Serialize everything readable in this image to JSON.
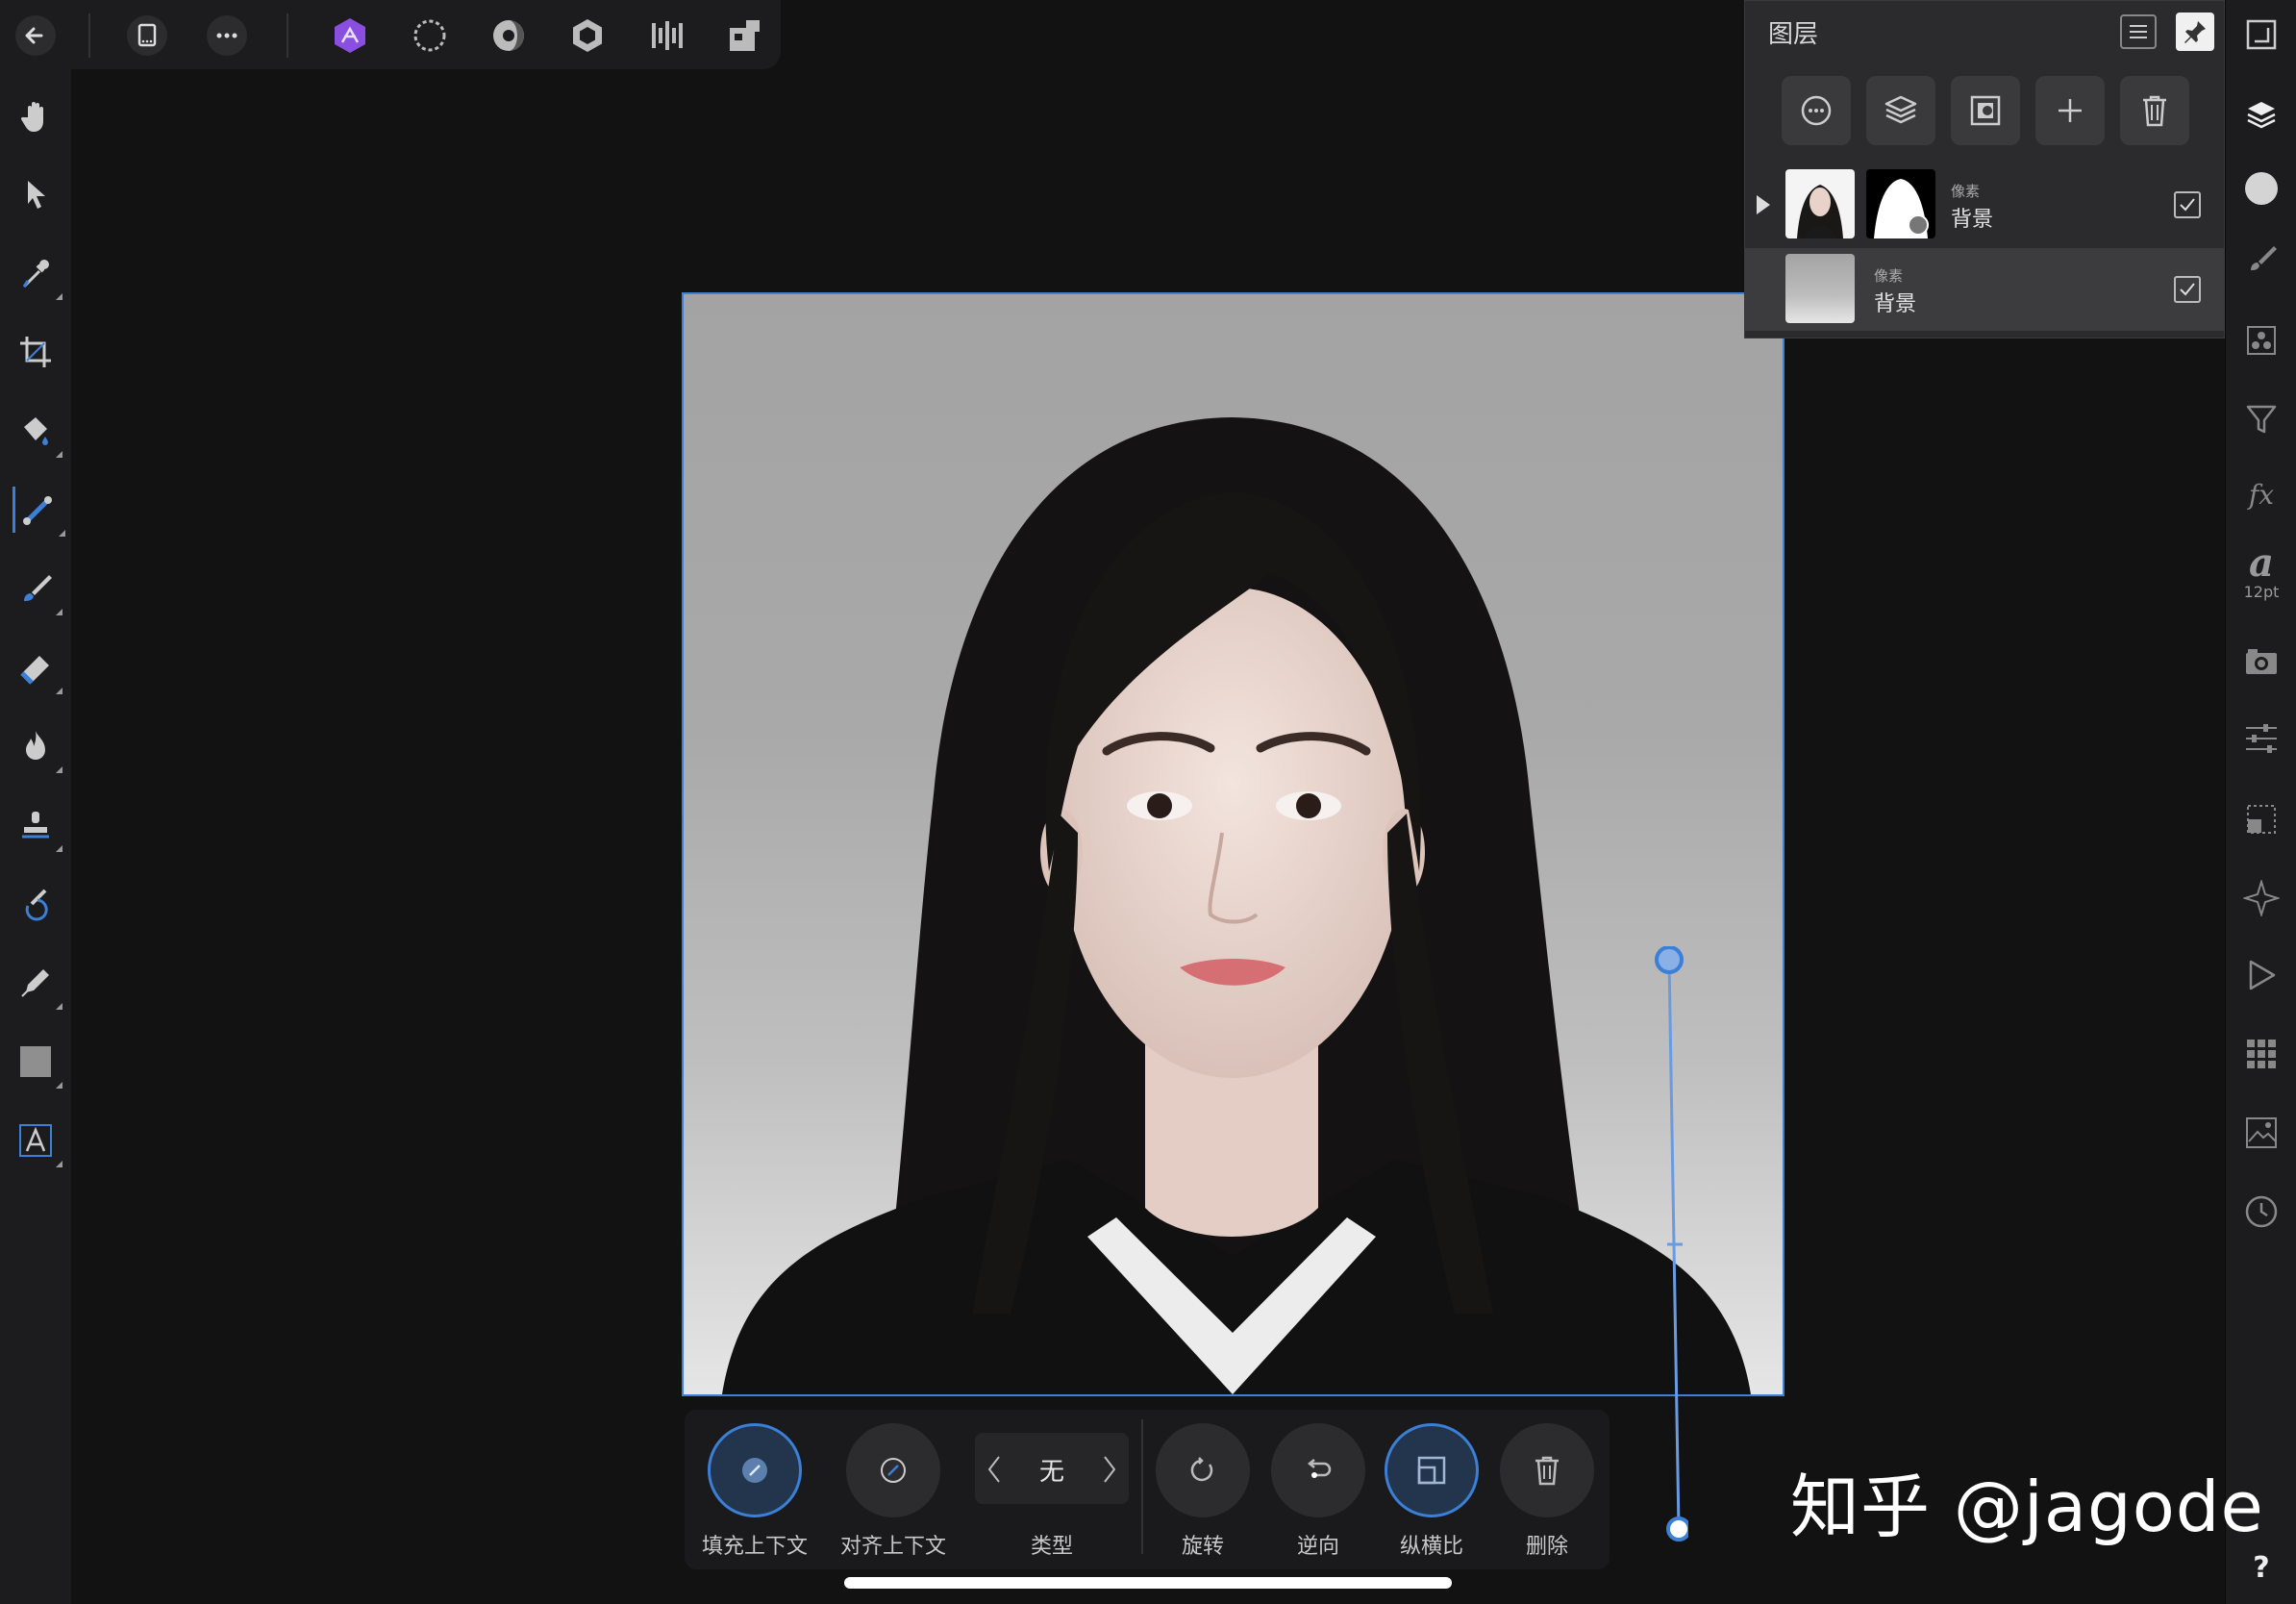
{
  "top_toolbar": {
    "items": [
      "back-icon",
      "document-icon",
      "more-icon",
      "photo-persona-icon",
      "liquify-persona-icon",
      "develop-persona-icon",
      "tone-mapping-persona-icon",
      "export-persona-icon",
      "pixel-persona-icon"
    ]
  },
  "left_tools": [
    "view-tool",
    "move-tool",
    "color-picker-tool",
    "crop-tool",
    "flood-fill-tool",
    "gradient-tool",
    "paint-brush-tool",
    "erase-brush-tool",
    "burn-brush-tool",
    "clone-tool",
    "undo-brush-tool",
    "pen-tool",
    "rectangle-tool",
    "artistic-text-tool"
  ],
  "right_strip": {
    "items": [
      "canvas-icon",
      "layers-icon",
      "color-icon",
      "brushes-icon",
      "channels-icon",
      "filter-icon",
      "fx-icon",
      "text-icon",
      "camera-icon",
      "adjustments-icon",
      "transform-icon",
      "navigator-icon",
      "macro-icon",
      "stock-icon",
      "image-icon",
      "history-icon",
      "help-icon"
    ],
    "text_size": "12pt",
    "fx_label": "fx",
    "text_glyph": "a",
    "help": "?"
  },
  "layers_panel": {
    "title": "图层",
    "layers": [
      {
        "type": "像素",
        "name": "背景",
        "checked": true,
        "expandable": true
      },
      {
        "type": "像素",
        "name": "背景",
        "checked": true,
        "expandable": false
      }
    ]
  },
  "context_toolbar": {
    "fill_context": "填充上下文",
    "align_context": "对齐上下文",
    "type_value": "无",
    "type_label": "类型",
    "rotate": "旋转",
    "reverse": "逆向",
    "aspect_ratio": "纵横比",
    "delete": "删除"
  },
  "watermark": "知乎 @jagode",
  "colors": {
    "accent": "#3b7fd6",
    "panel": "#1c1c1e",
    "canvas_bg": "#121212"
  }
}
